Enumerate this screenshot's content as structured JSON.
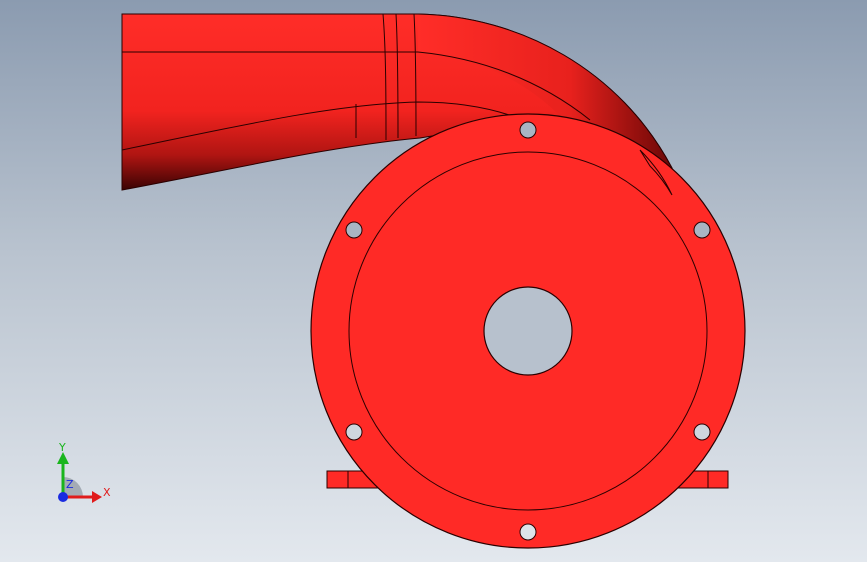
{
  "viewport": {
    "colors": {
      "part_fill": "#ff2a26",
      "part_edge": "#2a0000",
      "shadow": "#5a0605",
      "background_top": "#8b9bb0",
      "background_bottom": "#e3e8ee"
    }
  },
  "triad": {
    "y_label": "Y",
    "x_label": "X",
    "z_label": "Z",
    "colors": {
      "x": "#e01b1b",
      "y": "#19b51d",
      "z": "#1a2be0"
    }
  }
}
